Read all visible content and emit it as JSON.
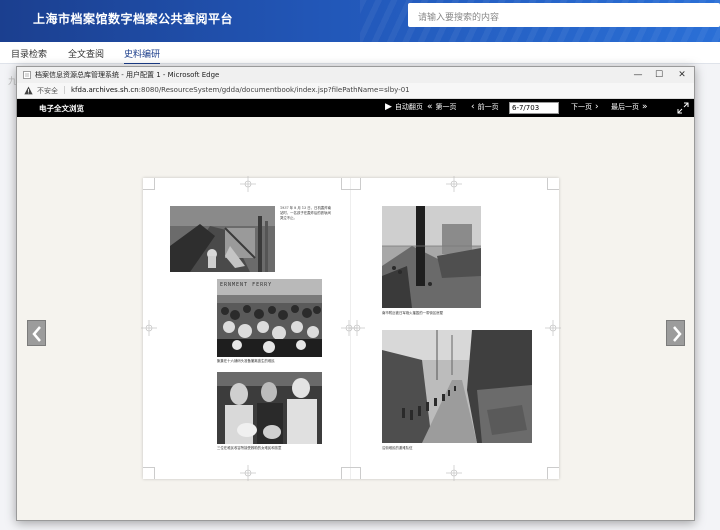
{
  "portal": {
    "title": "上海市档案馆数字档案公共查阅平台",
    "search_placeholder": "请输入要搜索的内容",
    "nav": [
      "目录检索",
      "全文查阅",
      "史料编研"
    ],
    "faint_text": "九"
  },
  "popup": {
    "window_title": "档案信息资源总库管理系统 - 用户配置 1 - Microsoft Edge",
    "controls": {
      "minimize": "—",
      "maximize": "☐",
      "close": "✕"
    },
    "security_label": "不安全",
    "url_host": "kfda.archives.sh.cn",
    "url_rest": ":8080/ResourceSystem/gdda/documentbook/index.jsp?filePathName=slby-01"
  },
  "viewer": {
    "title": "电子全文浏览",
    "autoplay": "自动翻页",
    "first": "第一页",
    "prev": "前一页",
    "page_value": "6-7/703",
    "next": "下一页",
    "last": "最后一页"
  },
  "book": {
    "captions": {
      "p1": "1937 年 8 月 13 日，日机轰炸南站时，一名孩子在轰炸后的铁轨间哭泣不止。",
      "p2": "聚集在十六铺码头准备撤离逃生的难民",
      "p3": "三位在难民收容所接受救助的女难民和孩童",
      "p4": "南市附近被日军炮火摧毁的一带街区房屋",
      "p5": "沿街难民的避难队伍"
    },
    "sign_text": "ERNMENT FERRY"
  },
  "colors": {
    "portal_blue": "#1b3f8f",
    "viewer_bar": "#000000",
    "page_bg": "#f5f3ee",
    "arrow_gray": "#9c9c9c"
  }
}
